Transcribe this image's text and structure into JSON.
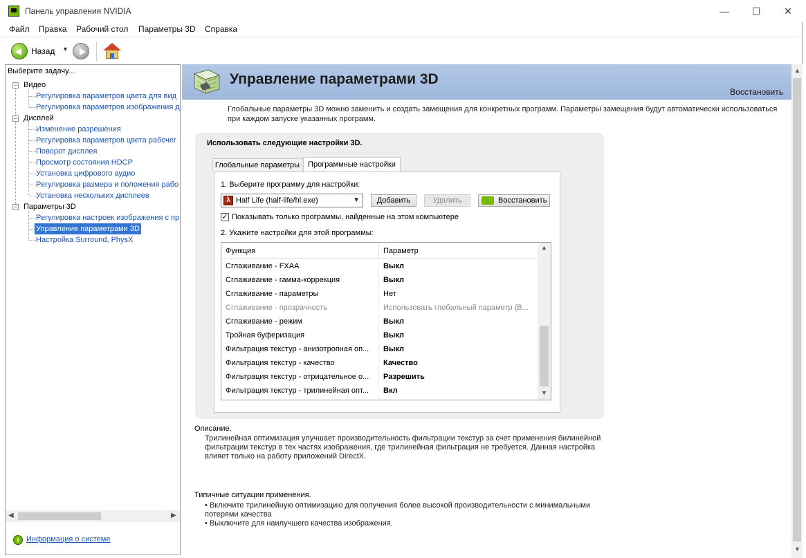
{
  "window": {
    "title": "Панель управления NVIDIA",
    "controls": {
      "minimize": "—",
      "maximize": "☐",
      "close": "✕"
    }
  },
  "menu": [
    "Файл",
    "Правка",
    "Рабочий стол",
    "Параметры 3D",
    "Справка"
  ],
  "toolbar": {
    "back_label": "Назад",
    "dropdown": "▼"
  },
  "left_panel": {
    "title": "Выберите задачу...",
    "tree": [
      {
        "label": "Видео",
        "expander": "−",
        "children": [
          "Регулировка параметров цвета для вид",
          "Регулировка параметров изображения д"
        ]
      },
      {
        "label": "Дисплей",
        "expander": "−",
        "children": [
          "Изменение разрешения",
          "Регулировка параметров цвета рабочег",
          "Поворот дисплея",
          "Просмотр состояния HDCP",
          "Установка цифрового аудио",
          "Регулировка размера и положения рабо",
          "Установка нескольких дисплеев"
        ]
      },
      {
        "label": "Параметры 3D",
        "expander": "−",
        "children": [
          "Регулировка настроек изображения с пр",
          "Управление параметрами 3D",
          "Настройка Surround, PhysX"
        ]
      }
    ],
    "selected": "Управление параметрами 3D",
    "system_info": "Информация о системе"
  },
  "page": {
    "title": "Управление параметрами 3D",
    "restore": "Восстановить",
    "intro": "Глобальные параметры 3D можно заменить и создать замещения для конкретных программ. Параметры замещения будут автоматически использоваться при каждом запуске указанных программ.",
    "settings_heading": "Использовать следующие настройки 3D.",
    "tabs": [
      "Глобальные параметры",
      "Программные настройки"
    ],
    "active_tab": "Программные настройки",
    "step1": "1. Выберите программу для настройки:",
    "program": "Half Life (half-life/hl.exe)",
    "buttons": {
      "add": "Добавить",
      "remove": "Удалить",
      "restore": "Восстановить"
    },
    "checkbox": {
      "checked": true,
      "mark": "✓",
      "label": "Показывать только программы, найденные на этом компьютере"
    },
    "step2": "2. Укажите настройки для этой программы:",
    "grid": {
      "headers": [
        "Функция",
        "Параметр"
      ],
      "rows": [
        {
          "func": "Сглаживание - FXAA",
          "value": "Выкл",
          "bold": true,
          "disabled": false
        },
        {
          "func": "Сглаживание - гамма-коррекция",
          "value": "Выкл",
          "bold": true,
          "disabled": false
        },
        {
          "func": "Сглаживание - параметры",
          "value": "Нет",
          "bold": false,
          "disabled": false
        },
        {
          "func": "Сглаживание - прозрачность",
          "value": "Использовать глобальный параметр (В...",
          "bold": false,
          "disabled": true
        },
        {
          "func": "Сглаживание - режим",
          "value": "Выкл",
          "bold": true,
          "disabled": false
        },
        {
          "func": "Тройная буферизация",
          "value": "Выкл",
          "bold": true,
          "disabled": false
        },
        {
          "func": "Фильтрация текстур - анизотропная оп...",
          "value": "Выкл",
          "bold": true,
          "disabled": false
        },
        {
          "func": "Фильтрация текстур - качество",
          "value": "Качество",
          "bold": true,
          "disabled": false
        },
        {
          "func": "Фильтрация текстур - отрицательное о...",
          "value": "Разрешить",
          "bold": true,
          "disabled": false
        },
        {
          "func": "Фильтрация текстур - трилинейная опт...",
          "value": "Вкл",
          "bold": true,
          "disabled": false
        }
      ]
    },
    "description_label": "Описание.",
    "description": "Трилинейная оптимизация улучшает производительность фильтрации текстур за счет применения билинейной фильтрации текстур в тех частях изображения, где трилинейная фильтрация не требуется. Данная настройка влияет только на работу приложений DirectX.",
    "typical_label": "Типичные ситуации применения.",
    "typical": [
      "• Включите трилинейную оптимизацию для получения более высокой производительности с минимальными потерями качества",
      "• Выключите для наилучшего качества изображения."
    ]
  },
  "scroll": {
    "up": "▲",
    "down": "▼",
    "left": "◀",
    "right": "▶"
  },
  "colors": {
    "selection": "#3275d3",
    "link": "#1a53b6",
    "banner": "#a9c1e3",
    "nvidia_green": "#76b900"
  }
}
